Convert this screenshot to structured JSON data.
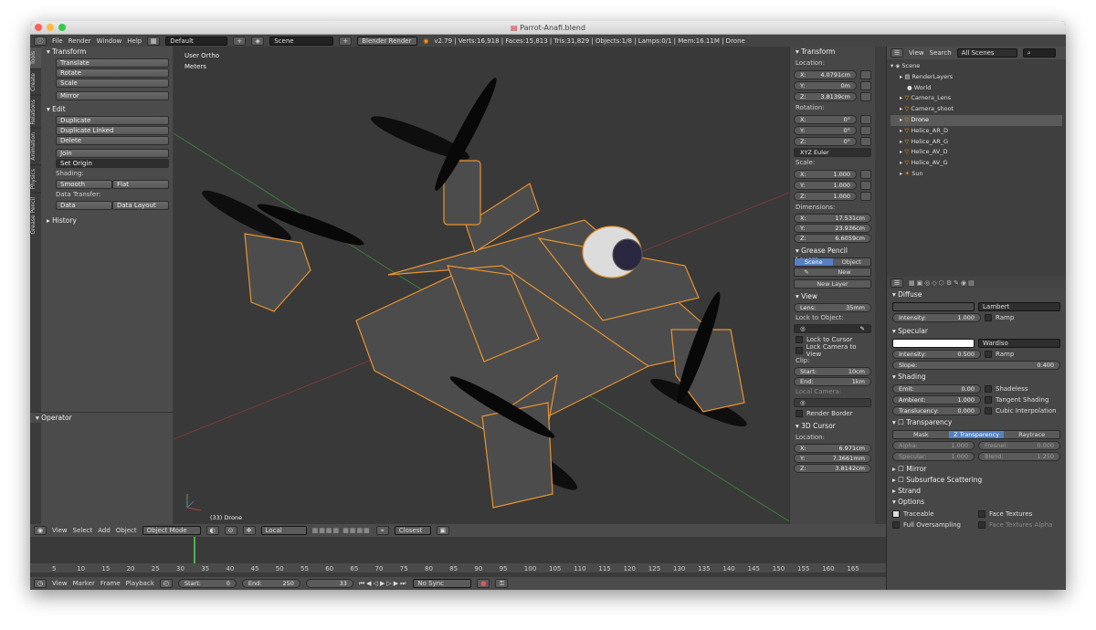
{
  "title": "Parrot-Anafi.blend",
  "menu": [
    "File",
    "Render",
    "Window",
    "Help"
  ],
  "layout_name": "Default",
  "scene_name": "Scene",
  "engine": "Blender Render",
  "stats": "v2.79 | Verts:16,918 | Faces:15,813 | Tris:31,829 | Objects:1/8 | Lamps:0/1 | Mem:16.11M | Drone",
  "tool_tabs": [
    "Tools",
    "Create",
    "Relations",
    "Animation",
    "Physics",
    "Grease Pencil"
  ],
  "tools": {
    "transform_title": "Transform",
    "transform": [
      "Translate",
      "Rotate",
      "Scale",
      "Mirror"
    ],
    "edit_title": "Edit",
    "edit": [
      "Duplicate",
      "Duplicate Linked",
      "Delete",
      "Join",
      "Set Origin"
    ],
    "shading_label": "Shading:",
    "smooth": "Smooth",
    "flat": "Flat",
    "data_transfer_label": "Data Transfer:",
    "data": "Data",
    "data_layout": "Data Layout",
    "history": "History",
    "operator": "Operator"
  },
  "viewport": {
    "view_name": "User Ortho",
    "units": "Meters",
    "object_label": "(33) Drone"
  },
  "viewport_header": [
    "View",
    "Select",
    "Add",
    "Object",
    "Object Mode",
    "Local",
    "Closest"
  ],
  "n_panel": {
    "transform": "Transform",
    "location": "Location:",
    "loc": [
      [
        "X:",
        "4.0791cm"
      ],
      [
        "Y:",
        "0m"
      ],
      [
        "Z:",
        "3.8139cm"
      ]
    ],
    "rotation": "Rotation:",
    "rot": [
      [
        "X:",
        "0°"
      ],
      [
        "Y:",
        "0°"
      ],
      [
        "Z:",
        "0°"
      ]
    ],
    "euler": "XYZ Euler",
    "scale": "Scale:",
    "scl": [
      [
        "X:",
        "1.000"
      ],
      [
        "Y:",
        "1.000"
      ],
      [
        "Z:",
        "1.000"
      ]
    ],
    "dimensions": "Dimensions:",
    "dim": [
      [
        "X:",
        "17.531cm"
      ],
      [
        "Y:",
        "23.936cm"
      ],
      [
        "Z:",
        "6.6059cm"
      ]
    ],
    "grease": "Grease Pencil Layers",
    "scene_tab": "Scene",
    "object_tab": "Object",
    "new": "New",
    "new_layer": "New Layer",
    "view": "View",
    "lens": "Lens:",
    "lens_val": "35mm",
    "lock_object": "Lock to Object:",
    "lock_cursor": "Lock to Cursor",
    "lock_camera": "Lock Camera to View",
    "clip": "Clip:",
    "clip_start": "Start:",
    "clip_start_val": "10cm",
    "clip_end": "End:",
    "clip_end_val": "1km",
    "local_camera": "Local Camera:",
    "render_border": "Render Border",
    "cursor": "3D Cursor",
    "cursor_loc": "Location:",
    "cur": [
      [
        "X:",
        "6.971cm"
      ],
      [
        "Y:",
        "7.3661mm"
      ],
      [
        "Z:",
        "3.8142cm"
      ]
    ]
  },
  "outliner": {
    "view": "View",
    "search": "Search",
    "filter": "All Scenes",
    "items": [
      "Scene",
      "RenderLayers",
      "World",
      "Camera_Lens",
      "Camera_shoot",
      "Drone",
      "Helice_AR_D",
      "Helice_AR_G",
      "Helice_AV_D",
      "Helice_AV_G",
      "Sun"
    ]
  },
  "props": {
    "diffuse": "Diffuse",
    "lambert": "Lambert",
    "intensity": "Intensity:",
    "intensity1": "1.000",
    "ramp": "Ramp",
    "specular": "Specular",
    "wardiso": "Wardiso",
    "intensity2": "0.500",
    "slope": "Slope:",
    "slope_val": "0.400",
    "shading": "Shading",
    "emit": "Emit:",
    "emit_val": "0.00",
    "shadeless": "Shadeless",
    "ambient": "Ambient:",
    "ambient_val": "1.000",
    "tangent": "Tangent Shading",
    "translucency": "Translucency:",
    "transl_val": "0.000",
    "cubic": "Cubic Interpolation",
    "transparency": "Transparency",
    "mask": "Mask",
    "ztrans": "Z Transparency",
    "raytrace": "Raytrace",
    "alpha": "Alpha:",
    "alpha_val": "1.000",
    "fresnel": "Fresnel:",
    "fresnel_val": "0.000",
    "spec": "Specular:",
    "spec_val": "1.000",
    "blend": "Blend:",
    "blend_val": "1.250",
    "mirror": "Mirror",
    "sss": "Subsurface Scattering",
    "strand": "Strand",
    "options": "Options",
    "traceable": "Traceable",
    "face_textures": "Face Textures",
    "full_os": "Full Oversampling",
    "face_tex_alpha": "Face Textures Alpha"
  },
  "timeline": {
    "ticks": [
      "5",
      "10",
      "15",
      "20",
      "25",
      "30",
      "35",
      "40",
      "45",
      "50",
      "55",
      "60",
      "65",
      "70",
      "75",
      "80",
      "85",
      "90",
      "95",
      "100",
      "105",
      "110",
      "115",
      "120",
      "125",
      "130",
      "135",
      "140",
      "145",
      "150",
      "155",
      "160",
      "165"
    ]
  },
  "timeline_header": {
    "menus": [
      "View",
      "Marker",
      "Frame",
      "Playback"
    ],
    "start_label": "Start:",
    "start": "0",
    "end_label": "End:",
    "end": "250",
    "current": "33",
    "sync": "No Sync"
  }
}
